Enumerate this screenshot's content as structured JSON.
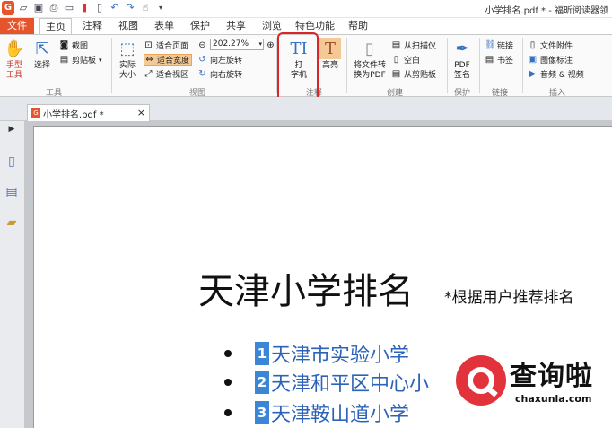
{
  "window": {
    "title": "小学排名.pdf * - 福昕阅读器领"
  },
  "quick_access": {
    "icons": [
      "foxit-logo-icon",
      "open-icon",
      "save-icon",
      "print-icon",
      "window-icon",
      "pdf-icon",
      "new-icon",
      "undo-icon",
      "redo-icon",
      "hand-icon",
      "dropdown-icon"
    ]
  },
  "menu": {
    "tabs": [
      "文件",
      "主页",
      "注释",
      "视图",
      "表单",
      "保护",
      "共享",
      "浏览",
      "特色功能",
      "帮助"
    ]
  },
  "ribbon": {
    "tools": {
      "hand_label": "手型\n工具",
      "select_label": "选择",
      "screenshot_label": "截图",
      "clipboard_label": "剪贴板",
      "group_label": "工具"
    },
    "view": {
      "actual_size_label": "实际\n大小",
      "fit_page_label": "适合页面",
      "fit_width_label": "适合宽度",
      "fit_view_label": "适合视区",
      "zoom_value": "202.27%",
      "rotate_left_label": "向左旋转",
      "rotate_right_label": "向右旋转",
      "group_label": "视图"
    },
    "comment": {
      "typewriter_label": "打\n字机",
      "highlight_label": "高亮",
      "group_label": "注释"
    },
    "create": {
      "convert_label": "将文件转\n换为PDF",
      "from_scanner_label": "从扫描仪",
      "blank_label": "空白",
      "from_clipboard_label": "从剪贴板",
      "group_label": "创建"
    },
    "protect": {
      "pdf_sign_label": "PDF\n签名",
      "group_label": "保护"
    },
    "links": {
      "link_label": "链接",
      "bookmark_label": "书签",
      "group_label": "链接"
    },
    "insert": {
      "file_attachment_label": "文件附件",
      "image_annotation_label": "图像标注",
      "audio_video_label": "音频 & 视频",
      "group_label": "插入"
    }
  },
  "document_tab": {
    "label": "小学排名.pdf *",
    "close": "×"
  },
  "page": {
    "heading": "天津小学排名",
    "heading_note": "*根据用户推荐排名",
    "items": [
      {
        "num": "1",
        "name": "天津市实验小学"
      },
      {
        "num": "2",
        "name": "天津和平区中心小"
      },
      {
        "num": "3",
        "name": "天津鞍山道小学"
      }
    ]
  },
  "watermark": {
    "text": "查询啦",
    "sub": "chaxunla.com"
  }
}
